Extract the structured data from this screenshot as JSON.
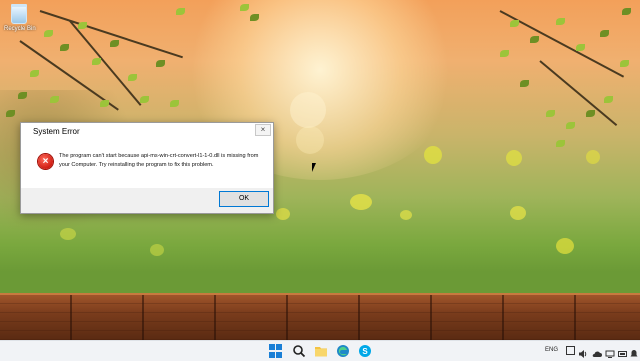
{
  "desktop": {
    "icon_label": "Recycle Bin"
  },
  "dialog": {
    "title": "System Error",
    "close_glyph": "×",
    "error_glyph": "×",
    "message": "The program can't start because api-ms-win-crt-convert-l1-1-0.dll is missing from your Computer. Try reinstalling the program to fix this problem.",
    "ok_label": "OK"
  },
  "taskbar": {
    "apps": [
      "start",
      "search",
      "file-explorer",
      "edge",
      "skype"
    ],
    "language": "ENG"
  },
  "colors": {
    "accent": "#0078d4",
    "error": "#d01c12"
  }
}
